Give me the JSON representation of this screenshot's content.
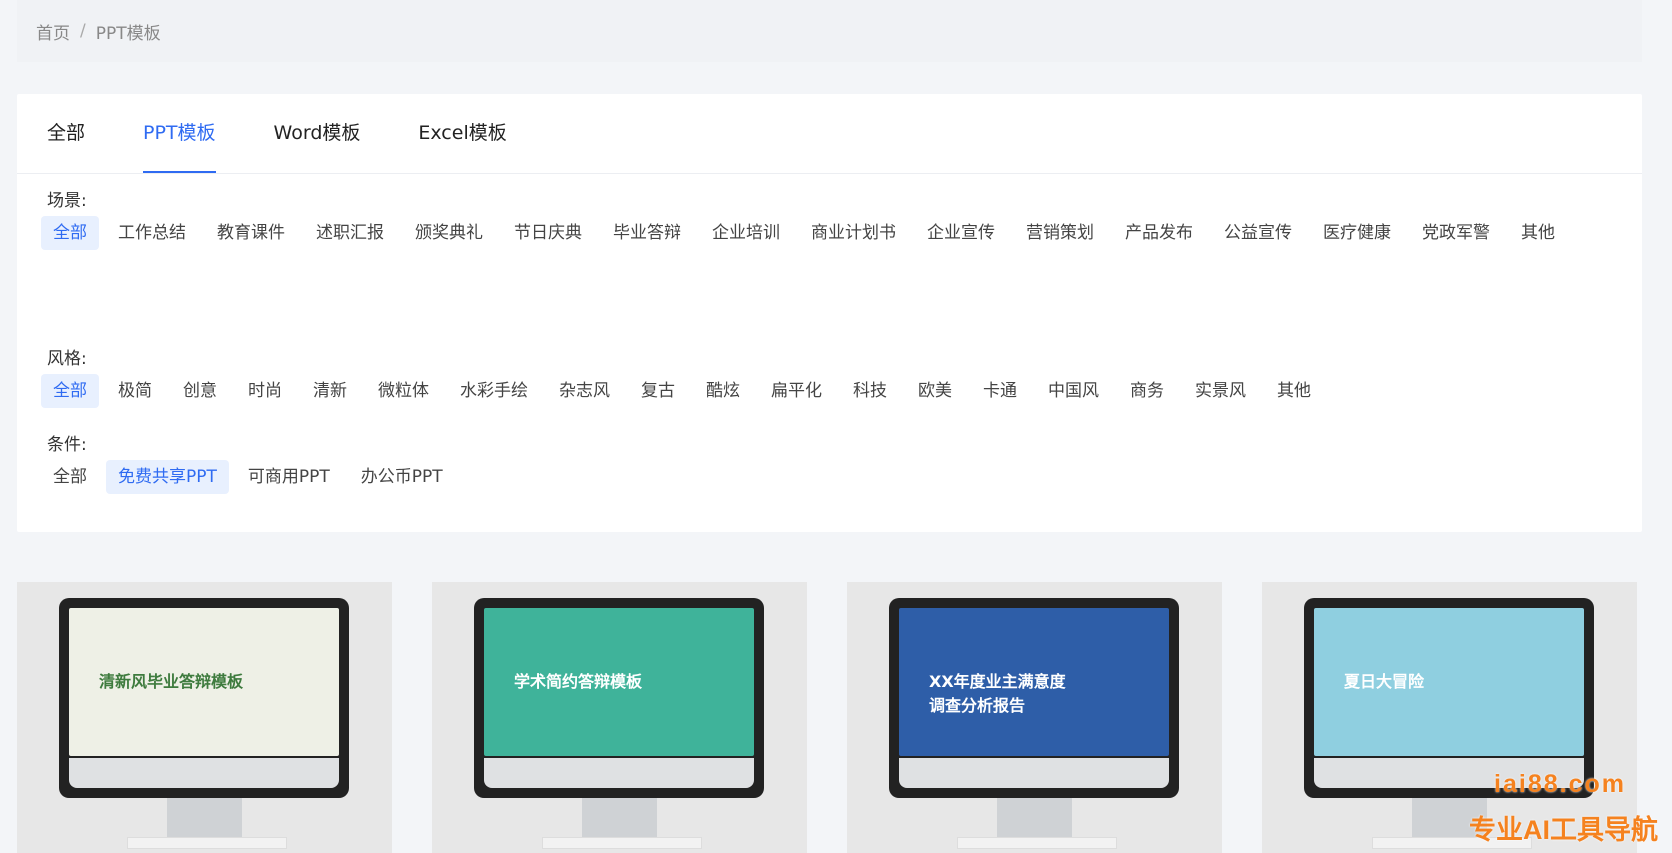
{
  "breadcrumb": {
    "home": "首页",
    "separator": "/",
    "current": "PPT模板"
  },
  "tabs": [
    {
      "label": "全部",
      "active": false
    },
    {
      "label": "PPT模板",
      "active": true
    },
    {
      "label": "Word模板",
      "active": false
    },
    {
      "label": "Excel模板",
      "active": false
    }
  ],
  "filters": {
    "scene": {
      "label": "场景:",
      "options": [
        "全部",
        "工作总结",
        "教育课件",
        "述职汇报",
        "颁奖典礼",
        "节日庆典",
        "毕业答辩",
        "企业培训",
        "商业计划书",
        "企业宣传",
        "营销策划",
        "产品发布",
        "公益宣传",
        "医疗健康",
        "党政军警",
        "其他"
      ],
      "selected": "全部"
    },
    "style": {
      "label": "风格:",
      "options": [
        "全部",
        "极简",
        "创意",
        "时尚",
        "清新",
        "微粒体",
        "水彩手绘",
        "杂志风",
        "复古",
        "酷炫",
        "扁平化",
        "科技",
        "欧美",
        "卡通",
        "中国风",
        "商务",
        "实景风",
        "其他"
      ],
      "selected": "全部"
    },
    "condition": {
      "label": "条件:",
      "options": [
        "全部",
        "免费共享PPT",
        "可商用PPT",
        "办公币PPT"
      ],
      "selected": "免费共享PPT"
    }
  },
  "cards": [
    {
      "screen_text": "清新风毕业答辩模板",
      "screen_color": "#eef0e6",
      "text_color": "#3e7b3e"
    },
    {
      "screen_text": "学术简约答辩模板",
      "screen_color": "#3fb39a",
      "text_color": "#ffffff"
    },
    {
      "screen_text": "XX年度业主满意度\n调查分析报告",
      "screen_color": "#2e5ea8",
      "text_color": "#ffffff"
    },
    {
      "screen_text": "夏日大冒险",
      "screen_color": "#8fcfe0",
      "text_color": "#ffffff"
    }
  ],
  "watermark": {
    "domain": "iai88.com",
    "tagline": "专业AI工具导航"
  }
}
